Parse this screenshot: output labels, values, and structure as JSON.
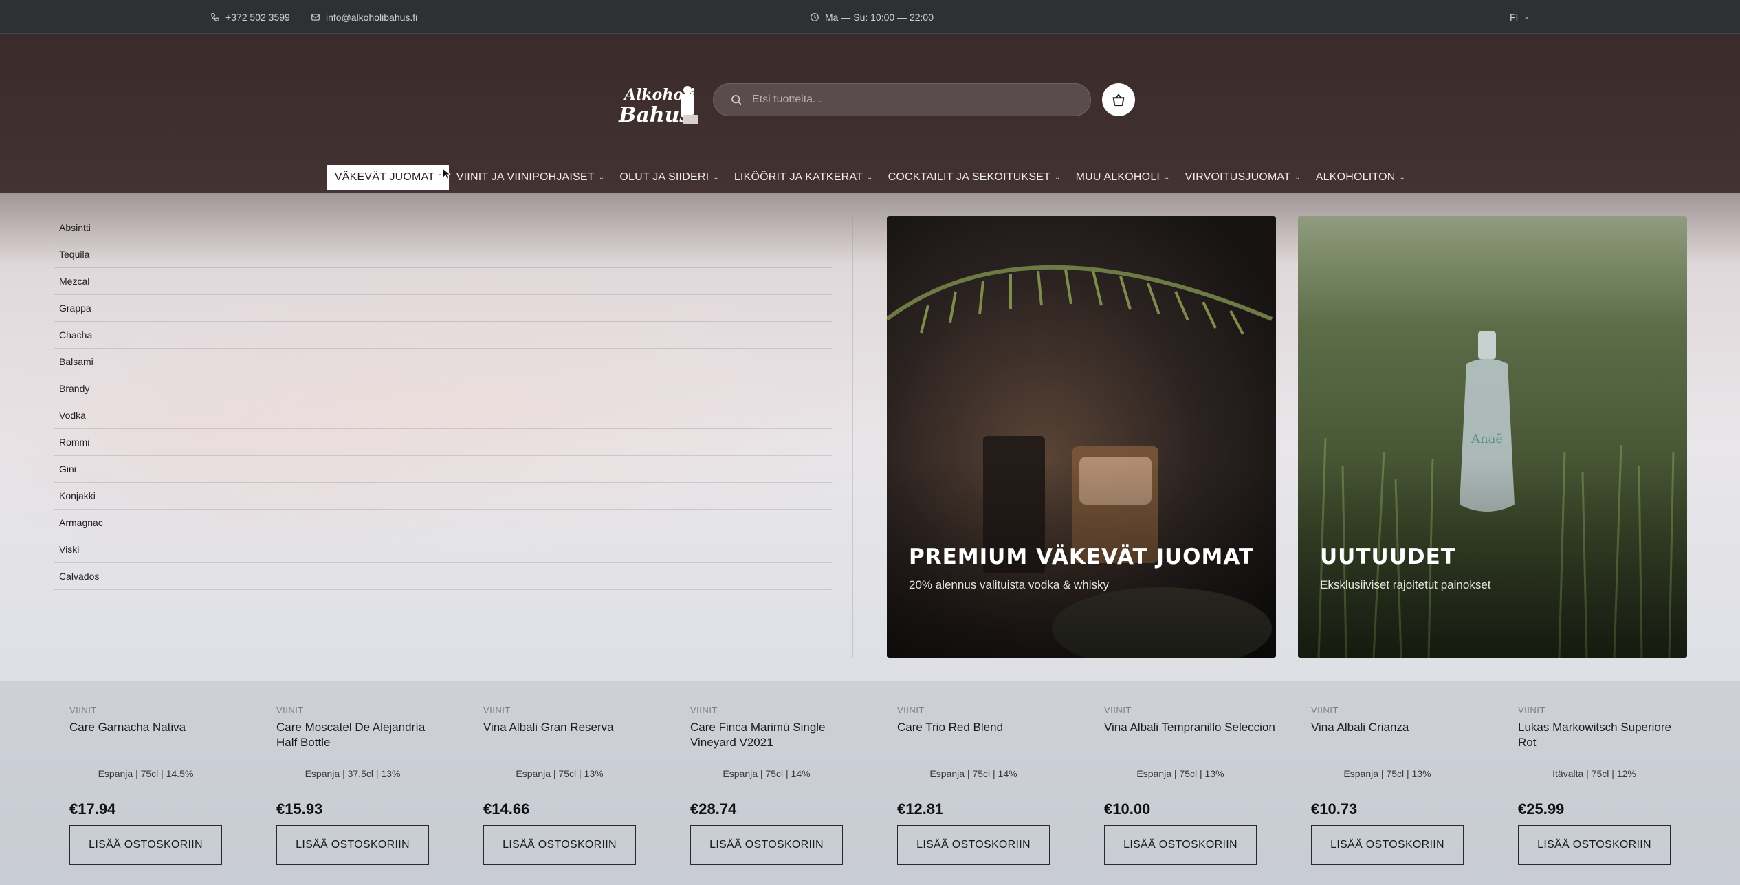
{
  "topbar": {
    "phone": "+372 502 3599",
    "email": "info@alkoholibahus.fi",
    "hours": "Ma — Su: 10:00 — 22:00",
    "language": "FI"
  },
  "header": {
    "logo_text_top": "Alkoholi",
    "logo_text_bottom": "Bahus",
    "search_placeholder": "Etsi tuotteita..."
  },
  "nav": {
    "items": [
      {
        "label": "VÄKEVÄT JUOMAT",
        "active": true
      },
      {
        "label": "VIINIT JA VIINIPOHJAISET"
      },
      {
        "label": "OLUT JA SIIDERI"
      },
      {
        "label": "LIKÖÖRIT JA KATKERAT"
      },
      {
        "label": "COCKTAILIT JA SEKOITUKSET"
      },
      {
        "label": "MUU ALKOHOLI"
      },
      {
        "label": "VIRVOITUSJUOMAT"
      },
      {
        "label": "ALKOHOLITON"
      }
    ]
  },
  "menu": {
    "categories": [
      "Absintti",
      "Tequila",
      "Mezcal",
      "Grappa",
      "Chacha",
      "Balsami",
      "Brandy",
      "Vodka",
      "Rommi",
      "Gini",
      "Konjakki",
      "Armagnac",
      "Viski",
      "Calvados"
    ],
    "promos": [
      {
        "title": "PREMIUM VÄKEVÄT JUOMAT",
        "subtitle": "20% alennus valituista vodka & whisky"
      },
      {
        "title": "UUTUUDET",
        "subtitle": "Eksklusiiviset rajoitetut painokset"
      }
    ]
  },
  "products": [
    {
      "category": "VIINIT",
      "name": "Care Garnacha Nativa",
      "meta": "Espanja | 75cl | 14.5%",
      "price": "€17.94",
      "button": "LISÄÄ OSTOSKORIIN"
    },
    {
      "category": "VIINIT",
      "name": "Care Moscatel De Alejandría Half Bottle",
      "meta": "Espanja | 37.5cl | 13%",
      "price": "€15.93",
      "button": "LISÄÄ OSTOSKORIIN"
    },
    {
      "category": "VIINIT",
      "name": "Vina Albali Gran Reserva",
      "meta": "Espanja | 75cl | 13%",
      "price": "€14.66",
      "button": "LISÄÄ OSTOSKORIIN"
    },
    {
      "category": "VIINIT",
      "name": "Care Finca Marimú Single Vineyard V2021",
      "meta": "Espanja | 75cl | 14%",
      "price": "€28.74",
      "button": "LISÄÄ OSTOSKORIIN"
    },
    {
      "category": "VIINIT",
      "name": "Care Trio Red Blend",
      "meta": "Espanja | 75cl | 14%",
      "price": "€12.81",
      "button": "LISÄÄ OSTOSKORIIN"
    },
    {
      "category": "VIINIT",
      "name": "Vina Albali Tempranillo Seleccion",
      "meta": "Espanja | 75cl | 13%",
      "price": "€10.00",
      "button": "LISÄÄ OSTOSKORIIN"
    },
    {
      "category": "VIINIT",
      "name": "Vina Albali Crianza",
      "meta": "Espanja | 75cl | 13%",
      "price": "€10.73",
      "button": "LISÄÄ OSTOSKORIIN"
    },
    {
      "category": "VIINIT",
      "name": "Lukas Markowitsch Superiore Rot",
      "meta": "Itävalta | 75cl | 12%",
      "price": "€25.99",
      "button": "LISÄÄ OSTOSKORIIN"
    }
  ],
  "icons": {
    "phone": "phone-icon",
    "email": "mail-icon",
    "clock": "clock-icon",
    "search": "search-icon",
    "cart": "basket-icon",
    "chevron": "chevron-down-icon"
  }
}
